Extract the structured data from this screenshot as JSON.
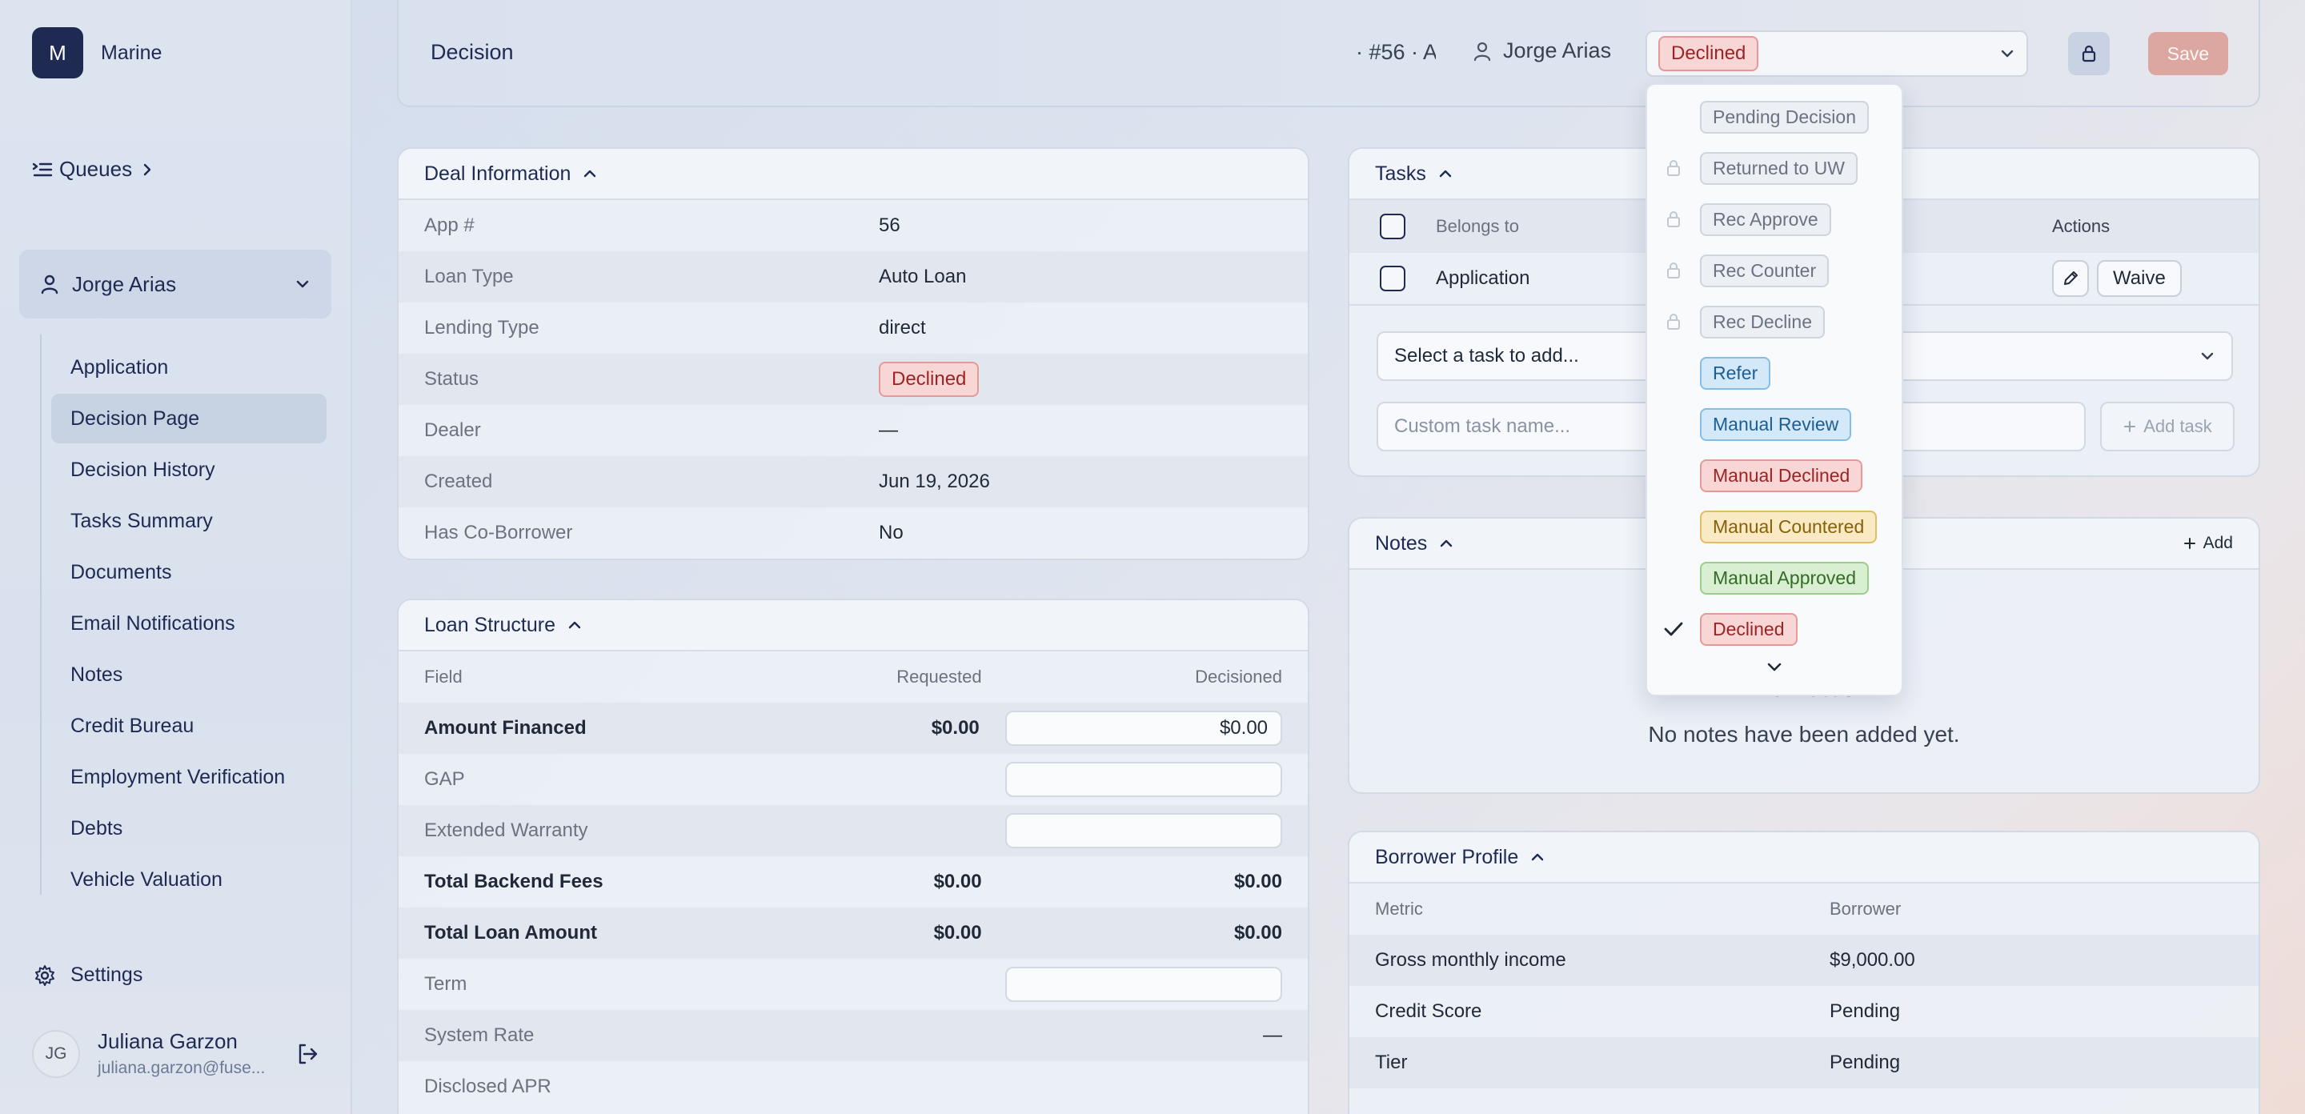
{
  "sidebar": {
    "org_initial": "M",
    "org_name": "Marine",
    "queues_label": "Queues",
    "borrower_name": "Jorge Arias",
    "nav": [
      {
        "label": "Application"
      },
      {
        "label": "Decision Page",
        "active": true
      },
      {
        "label": "Decision History"
      },
      {
        "label": "Tasks Summary"
      },
      {
        "label": "Documents"
      },
      {
        "label": "Email Notifications"
      },
      {
        "label": "Notes"
      },
      {
        "label": "Credit Bureau"
      },
      {
        "label": "Employment Verification"
      },
      {
        "label": "Debts"
      },
      {
        "label": "Vehicle Valuation"
      }
    ],
    "settings_label": "Settings",
    "user": {
      "initials": "JG",
      "name": "Juliana Garzon",
      "email": "juliana.garzon@fuse..."
    }
  },
  "topbar": {
    "title": "Decision",
    "meta": "· #56 · A",
    "borrower": "Jorge Arias",
    "status_value": "Declined",
    "save_label": "Save"
  },
  "deal": {
    "title": "Deal Information",
    "rows": [
      {
        "k": "App #",
        "v": "56"
      },
      {
        "k": "Loan Type",
        "v": "Auto Loan"
      },
      {
        "k": "Lending Type",
        "v": "direct"
      },
      {
        "k": "Status",
        "v": "Declined"
      },
      {
        "k": "Dealer",
        "v": "—"
      },
      {
        "k": "Created",
        "v": "Jun 19, 2026"
      },
      {
        "k": "Has Co-Borrower",
        "v": "No"
      }
    ]
  },
  "loan": {
    "title": "Loan Structure",
    "headers": {
      "field": "Field",
      "requested": "Requested",
      "decisioned": "Decisioned"
    },
    "rows": [
      {
        "field": "Amount Financed",
        "requested": "$0.00",
        "decisioned": "$0.00"
      },
      {
        "field": "GAP",
        "requested": "",
        "decisioned": ""
      },
      {
        "field": "Extended Warranty",
        "requested": "",
        "decisioned": ""
      },
      {
        "field": "Total Backend Fees",
        "requested": "$0.00",
        "decisioned": "$0.00"
      },
      {
        "field": "Total Loan Amount",
        "requested": "$0.00",
        "decisioned": "$0.00"
      },
      {
        "field": "Term",
        "requested": "",
        "decisioned": ""
      },
      {
        "field": "System Rate",
        "requested": "",
        "decisioned": "—"
      },
      {
        "field": "Disclosed APR",
        "requested": "",
        "decisioned": ""
      }
    ]
  },
  "tasks": {
    "title": "Tasks",
    "headers": {
      "belongs_to": "Belongs to",
      "actions": "Actions"
    },
    "rows": [
      {
        "belongs_to": "Application",
        "waive_label": "Waive"
      }
    ],
    "select_placeholder": "Select a task to add...",
    "custom_placeholder": "Custom task name...",
    "add_task_label": "Add task"
  },
  "notes": {
    "title": "Notes",
    "add_label": "Add",
    "empty_title": "No notes",
    "empty_sub": "No notes have been added yet."
  },
  "borrower_profile": {
    "title": "Borrower Profile",
    "headers": {
      "metric": "Metric",
      "borrower": "Borrower"
    },
    "rows": [
      {
        "metric": "Gross monthly income",
        "value": "$9,000.00"
      },
      {
        "metric": "Credit Score",
        "value": "Pending"
      },
      {
        "metric": "Tier",
        "value": "Pending"
      }
    ]
  },
  "status_dropdown": {
    "options": [
      {
        "label": "Pending Decision",
        "style": "gray",
        "locked": false,
        "selected": false
      },
      {
        "label": "Returned to UW",
        "style": "gray",
        "locked": true,
        "selected": false
      },
      {
        "label": "Rec Approve",
        "style": "gray",
        "locked": true,
        "selected": false
      },
      {
        "label": "Rec Counter",
        "style": "gray",
        "locked": true,
        "selected": false
      },
      {
        "label": "Rec Decline",
        "style": "gray",
        "locked": true,
        "selected": false
      },
      {
        "label": "Refer",
        "style": "blue",
        "locked": false,
        "selected": false
      },
      {
        "label": "Manual Review",
        "style": "blue",
        "locked": false,
        "selected": false
      },
      {
        "label": "Manual Declined",
        "style": "red",
        "locked": false,
        "selected": false
      },
      {
        "label": "Manual Countered",
        "style": "yellow",
        "locked": false,
        "selected": false
      },
      {
        "label": "Manual Approved",
        "style": "green",
        "locked": false,
        "selected": false
      },
      {
        "label": "Declined",
        "style": "red",
        "locked": false,
        "selected": true
      }
    ]
  },
  "colors": {
    "navy": "#1e2a52",
    "save": "#dba7a0",
    "declined_bg": "#f9d6d6",
    "declined_text": "#9b2424"
  }
}
